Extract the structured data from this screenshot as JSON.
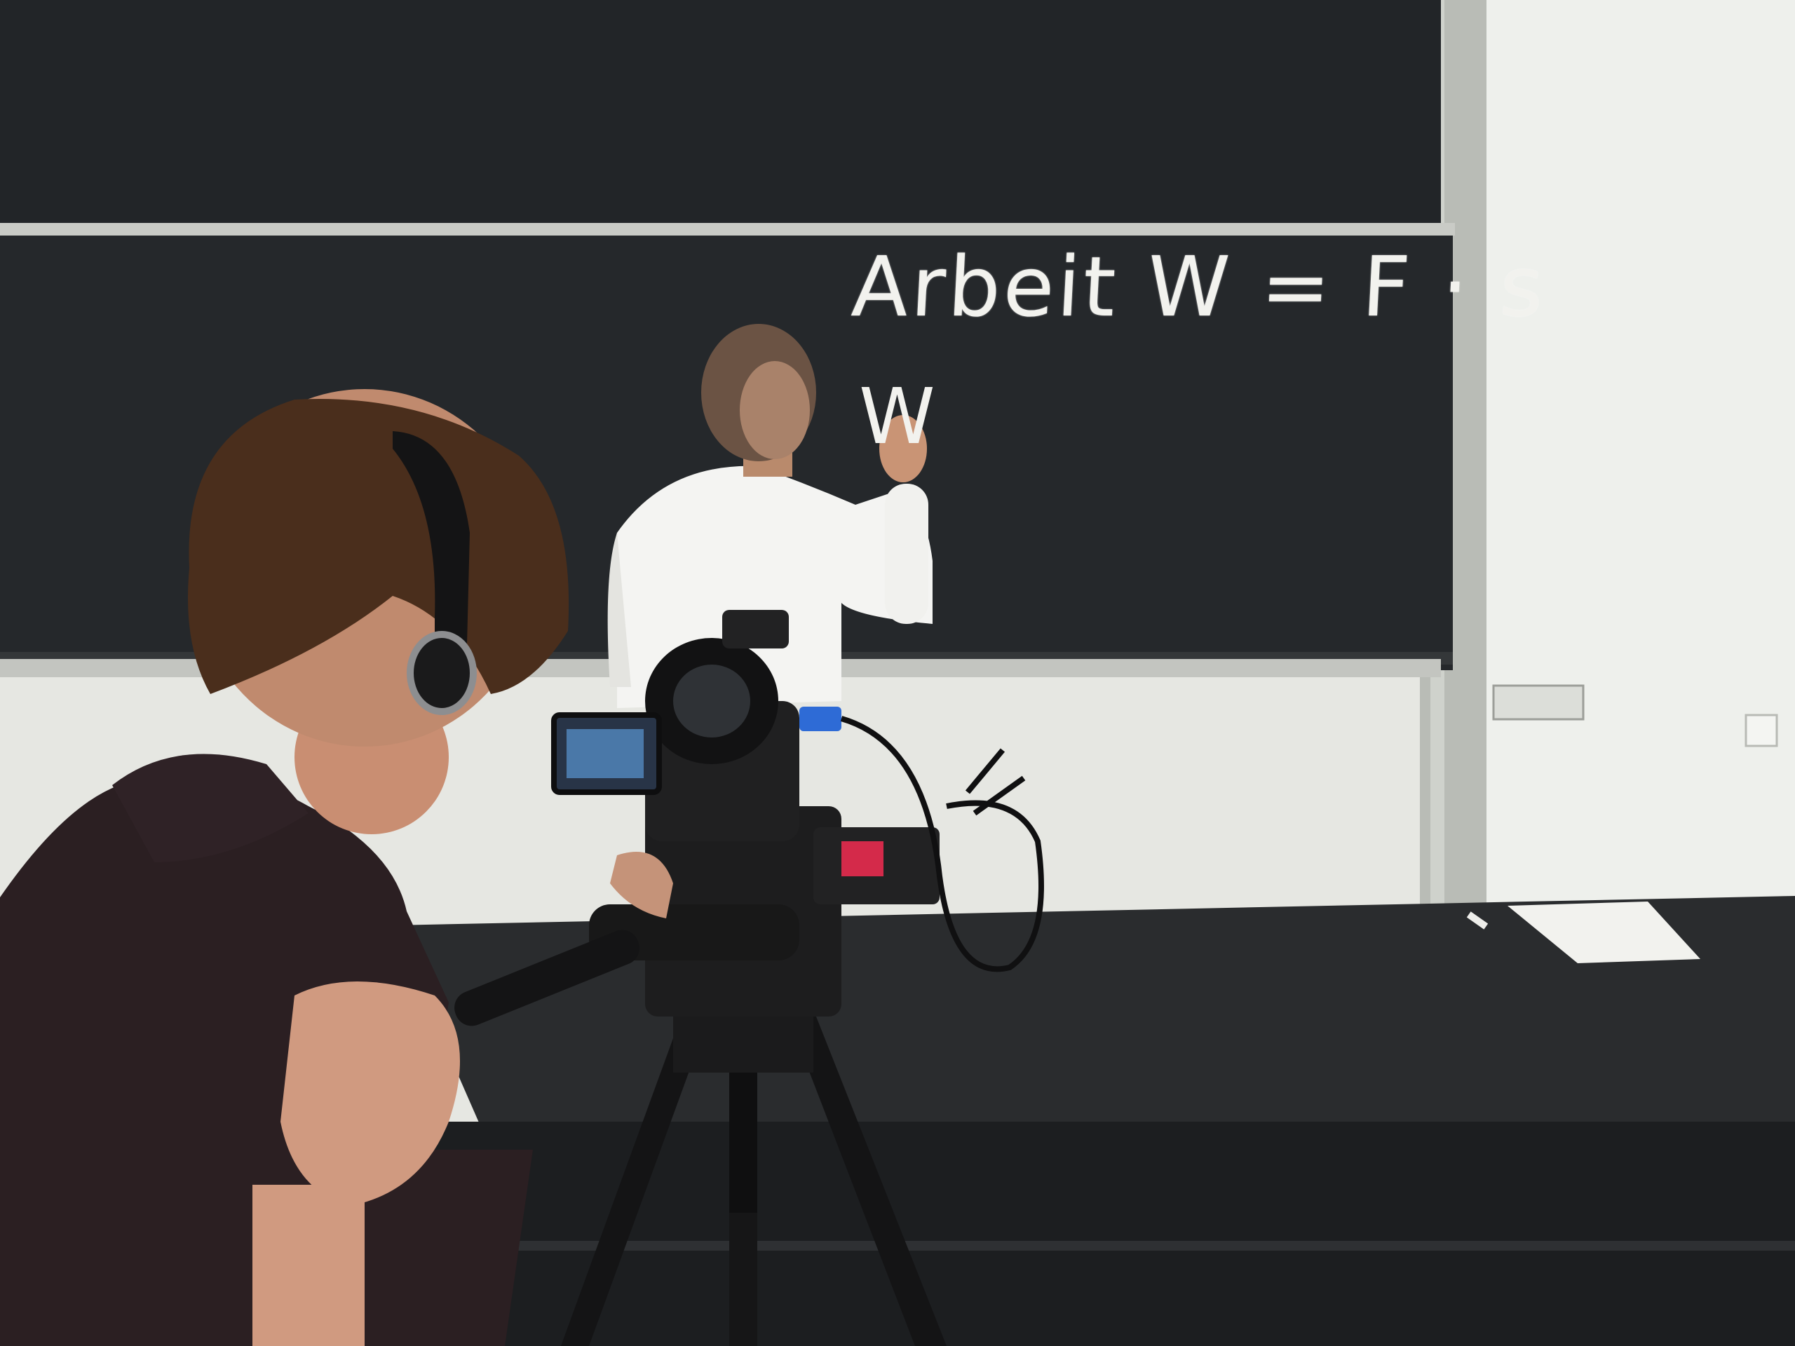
{
  "blackboard": {
    "formula": "Arbeit W = F · s",
    "partial_text": "W"
  },
  "colors": {
    "board": "#24272a",
    "board_upper": "#222528",
    "wall": "#e8e9e4",
    "desk": "#1f2123",
    "shirt": "#f4f4f2",
    "sweater": "#2b1f22",
    "hair": "#4a2e1c"
  },
  "icons": [
    "headphones-icon",
    "video-camera-icon",
    "tripod-icon",
    "chalk-icon",
    "paper-sheet-icon",
    "wall-switch-icon"
  ]
}
